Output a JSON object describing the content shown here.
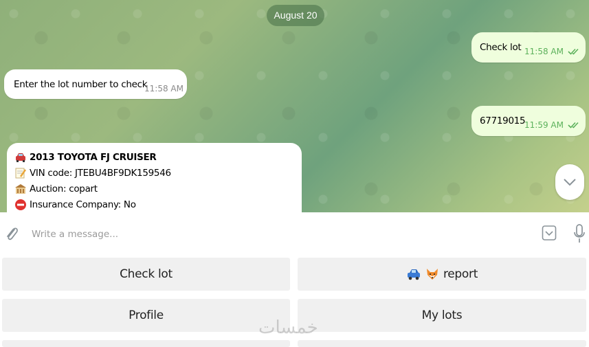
{
  "chat": {
    "date_label": "August 20",
    "messages": [
      {
        "direction": "out",
        "text": "Check lot",
        "time": "11:58 AM",
        "status": "read"
      },
      {
        "direction": "in",
        "text": "Enter the lot number to check",
        "time": "11:58 AM"
      },
      {
        "direction": "out",
        "text": "67719015",
        "time": "11:59 AM",
        "status": "read"
      }
    ],
    "lot_card": {
      "title": "2013 TOYOTA FJ CRUISER",
      "vin": "VIN code: JTEBU4BF9DK159546",
      "auction": "Auction: copart",
      "insurance": "Insurance Company: No",
      "icons": [
        "car-icon",
        "memo-icon",
        "bank-icon",
        "no-entry-icon"
      ]
    }
  },
  "composer": {
    "placeholder": "Write a message...",
    "value": ""
  },
  "keyboard": {
    "buttons": [
      {
        "label": "Check lot"
      },
      {
        "label": "report",
        "icons": [
          "car-icon",
          "fox-icon"
        ]
      },
      {
        "label": "Profile"
      },
      {
        "label": "My lots"
      }
    ]
  },
  "watermark": "خمسات",
  "colors": {
    "outgoing_bubble": "#effedd",
    "incoming_bubble": "#ffffff",
    "read_ticks": "#5cb15b",
    "keyboard_button": "#f0f0f0"
  }
}
